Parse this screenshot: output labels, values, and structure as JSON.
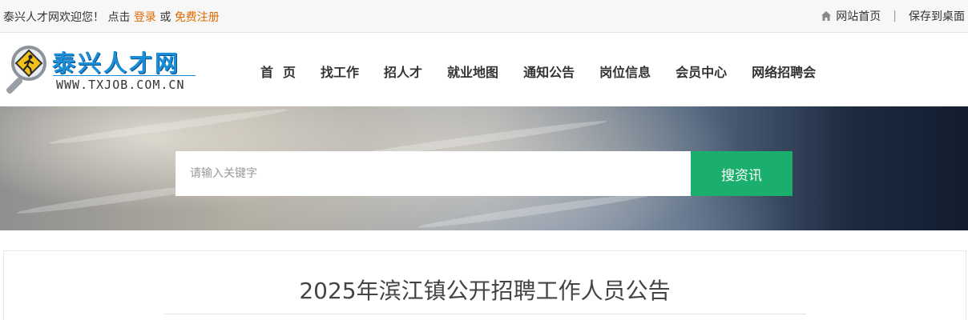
{
  "topbar": {
    "welcome": "泰兴人才网欢迎您！ 点击 ",
    "login": "登录",
    "or": " 或 ",
    "register": "免费注册",
    "home_link": "网站首页",
    "separator": "|",
    "save_desktop": "保存到桌面",
    "home_icon": "home-icon",
    "link_color": "#e06a00"
  },
  "logo": {
    "title": "泰兴人才网",
    "url": "WWW.TXJOB.COM.CN"
  },
  "nav": {
    "items": [
      "首页",
      "找工作",
      "招人才",
      "就业地图",
      "通知公告",
      "岗位信息",
      "会员中心",
      "网络招聘会"
    ]
  },
  "search": {
    "placeholder": "请输入关键字",
    "value": "",
    "button_label": "搜资讯",
    "button_color": "#1aaf6c"
  },
  "article": {
    "title": "2025年滨江镇公开招聘工作人员公告"
  }
}
